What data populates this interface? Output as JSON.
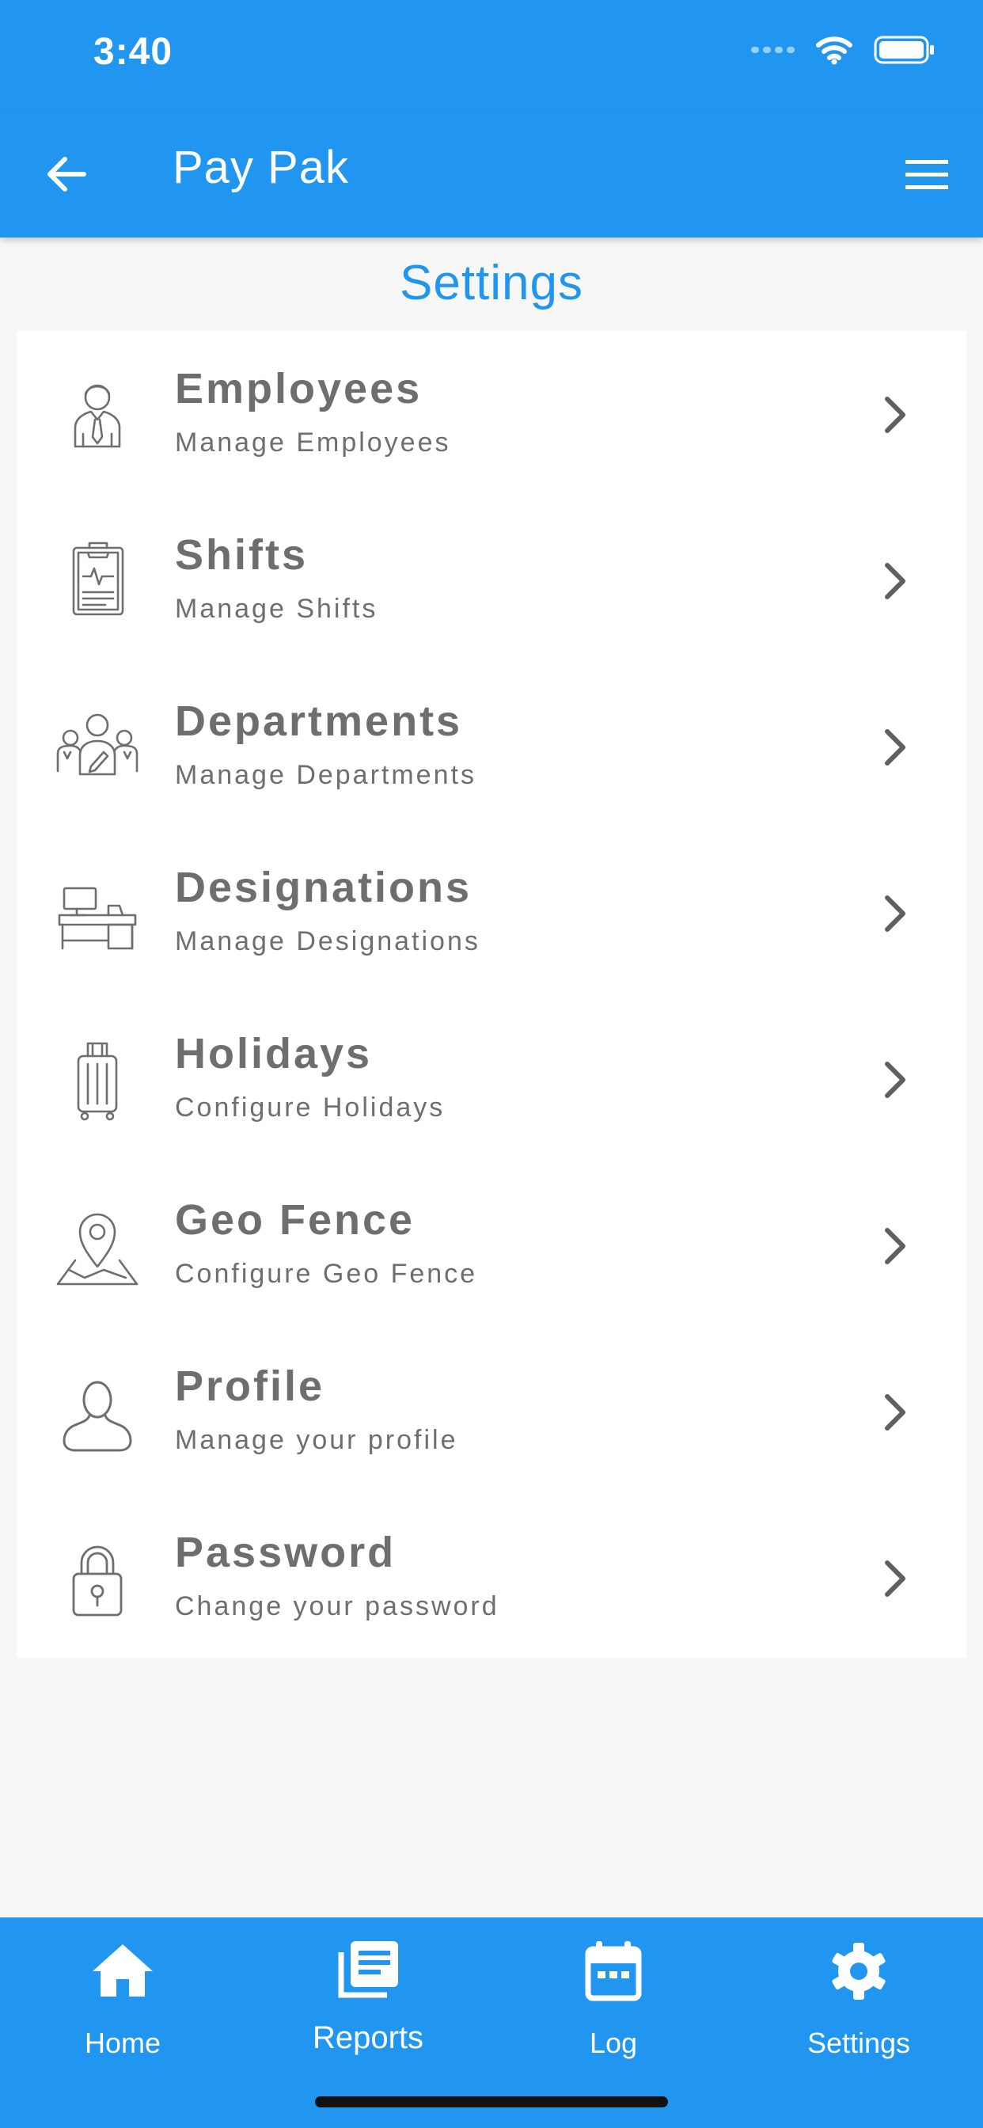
{
  "status_bar": {
    "time": "3:40"
  },
  "app_bar": {
    "title": "Pay Pak"
  },
  "page": {
    "title": "Settings"
  },
  "settings_items": [
    {
      "title": "Employees",
      "subtitle": "Manage Employees",
      "icon": "employee-icon"
    },
    {
      "title": "Shifts",
      "subtitle": "Manage Shifts",
      "icon": "clipboard-icon"
    },
    {
      "title": "Departments",
      "subtitle": "Manage Departments",
      "icon": "team-icon"
    },
    {
      "title": "Designations",
      "subtitle": "Manage Designations",
      "icon": "desk-icon"
    },
    {
      "title": "Holidays",
      "subtitle": "Configure Holidays",
      "icon": "luggage-icon"
    },
    {
      "title": "Geo Fence",
      "subtitle": "Configure Geo Fence",
      "icon": "map-pin-icon"
    },
    {
      "title": "Profile",
      "subtitle": "Manage your profile",
      "icon": "user-icon"
    },
    {
      "title": "Password",
      "subtitle": "Change your password",
      "icon": "lock-icon"
    }
  ],
  "bottom_nav": {
    "items": [
      {
        "label": "Home",
        "icon": "home-icon"
      },
      {
        "label": "Reports",
        "icon": "reports-icon"
      },
      {
        "label": "Log",
        "icon": "calendar-icon"
      },
      {
        "label": "Settings",
        "icon": "gear-icon"
      }
    ]
  },
  "colors": {
    "primary": "#2196f0",
    "text": "#6e6e6e",
    "background": "#f7f7f7"
  }
}
